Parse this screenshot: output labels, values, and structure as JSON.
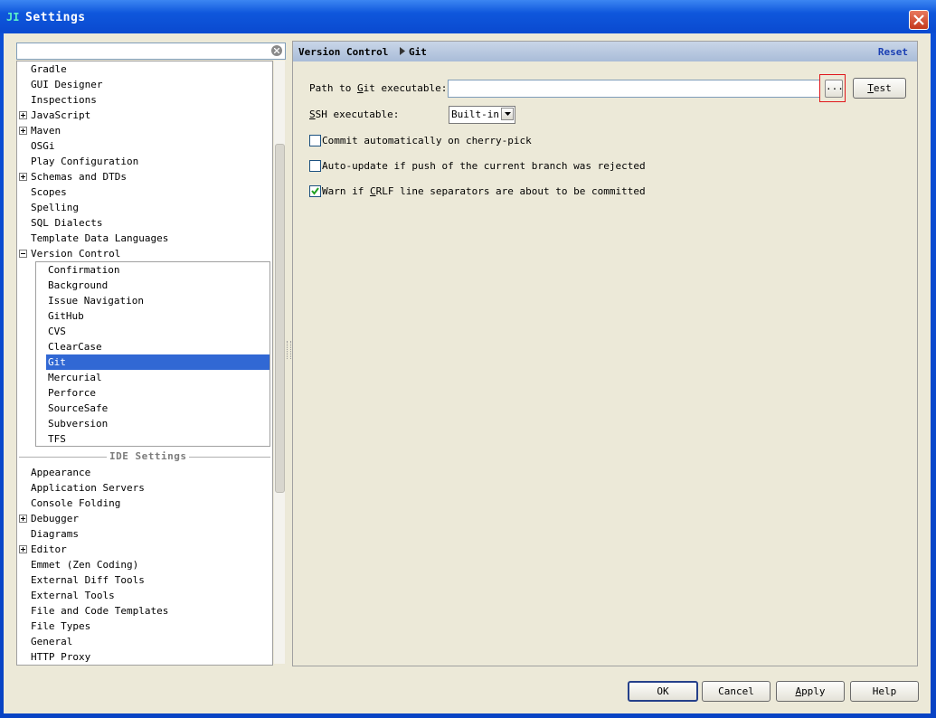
{
  "window": {
    "title": "Settings",
    "icon_text": "JI"
  },
  "search": {
    "value": "",
    "placeholder": ""
  },
  "tree": {
    "top_items": [
      {
        "label": "Gradle",
        "expander": ""
      },
      {
        "label": "GUI Designer",
        "expander": ""
      },
      {
        "label": "Inspections",
        "expander": ""
      },
      {
        "label": "JavaScript",
        "expander": "plus"
      },
      {
        "label": "Maven",
        "expander": "plus"
      },
      {
        "label": "OSGi",
        "expander": ""
      },
      {
        "label": "Play Configuration",
        "expander": ""
      },
      {
        "label": "Schemas and DTDs",
        "expander": "plus"
      },
      {
        "label": "Scopes",
        "expander": ""
      },
      {
        "label": "Spelling",
        "expander": ""
      },
      {
        "label": "SQL Dialects",
        "expander": ""
      },
      {
        "label": "Template Data Languages",
        "expander": ""
      },
      {
        "label": "Version Control",
        "expander": "minus"
      }
    ],
    "version_control_children": [
      {
        "label": "Confirmation"
      },
      {
        "label": "Background"
      },
      {
        "label": "Issue Navigation"
      },
      {
        "label": "GitHub"
      },
      {
        "label": "CVS"
      },
      {
        "label": "ClearCase"
      },
      {
        "label": "Git",
        "selected": true
      },
      {
        "label": "Mercurial"
      },
      {
        "label": "Perforce"
      },
      {
        "label": "SourceSafe"
      },
      {
        "label": "Subversion"
      },
      {
        "label": "TFS"
      }
    ],
    "ide_settings_label": "IDE Settings",
    "ide_items": [
      {
        "label": "Appearance",
        "expander": ""
      },
      {
        "label": "Application Servers",
        "expander": ""
      },
      {
        "label": "Console Folding",
        "expander": ""
      },
      {
        "label": "Debugger",
        "expander": "plus"
      },
      {
        "label": "Diagrams",
        "expander": ""
      },
      {
        "label": "Editor",
        "expander": "plus"
      },
      {
        "label": "Emmet (Zen Coding)",
        "expander": ""
      },
      {
        "label": "External Diff Tools",
        "expander": ""
      },
      {
        "label": "External Tools",
        "expander": ""
      },
      {
        "label": "File and Code Templates",
        "expander": ""
      },
      {
        "label": "File Types",
        "expander": ""
      },
      {
        "label": "General",
        "expander": ""
      },
      {
        "label": "HTTP Proxy",
        "expander": ""
      }
    ]
  },
  "panel": {
    "breadcrumb_parent": "Version Control",
    "breadcrumb_current": "Git",
    "reset_label": "Reset",
    "path_label_pre": "Path to ",
    "path_label_mnemonic": "G",
    "path_label_post": "it executable:",
    "path_value": "",
    "browse_label": "...",
    "test_mnemonic": "T",
    "test_rest": "est",
    "ssh_label_mnemonic": "S",
    "ssh_label_rest": "SH executable:",
    "ssh_value": "Built-in",
    "checkboxes": [
      {
        "label": "Commit automatically on cherry-pick",
        "checked": false
      },
      {
        "label": "Auto-update if push of the current branch was rejected",
        "checked": false
      },
      {
        "label_pre": "Warn if ",
        "label_mnemonic": "C",
        "label_post": "RLF line separators are about to be committed",
        "checked": true
      }
    ]
  },
  "buttons": {
    "ok": "OK",
    "cancel": "Cancel",
    "apply_mnemonic": "A",
    "apply_rest": "pply",
    "help": "Help"
  },
  "colors": {
    "selection": "#3168d4",
    "highlight_box": "#e0171b",
    "reset_link": "#1b3fb3"
  }
}
